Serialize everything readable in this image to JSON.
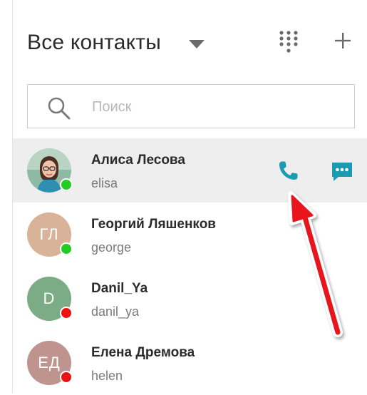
{
  "header": {
    "title": "Все контакты",
    "dropdown_icon": "caret-down-icon",
    "dialpad_icon": "dialpad-icon",
    "add_icon": "plus-icon"
  },
  "search": {
    "placeholder": "Поиск",
    "value": "",
    "icon": "search-icon"
  },
  "colors": {
    "accent": "#1a9bb0",
    "online": "#22cc22",
    "offline": "#ee1111",
    "annotation_arrow": "#e8141b",
    "selected_row": "#eeeeee"
  },
  "contacts": [
    {
      "name": "Алиса Лесова",
      "login": "elisa",
      "initials": "",
      "avatar": "photo",
      "avatar_color": "#5b9fb8",
      "status": "online",
      "selected": true
    },
    {
      "name": "Георгий Ляшенков",
      "login": "george",
      "initials": "ГЛ",
      "avatar": "initials",
      "avatar_color": "#d8b399",
      "status": "online",
      "selected": false
    },
    {
      "name": "Danil_Ya",
      "login": "danil_ya",
      "initials": "D",
      "avatar": "initials",
      "avatar_color": "#7cac86",
      "status": "offline",
      "selected": false
    },
    {
      "name": "Елена Дремова",
      "login": "helen",
      "initials": "ЕД",
      "avatar": "initials",
      "avatar_color": "#c0948e",
      "status": "offline",
      "selected": false
    }
  ],
  "actions": {
    "call_icon": "phone-icon",
    "chat_icon": "chat-bubble-icon"
  }
}
